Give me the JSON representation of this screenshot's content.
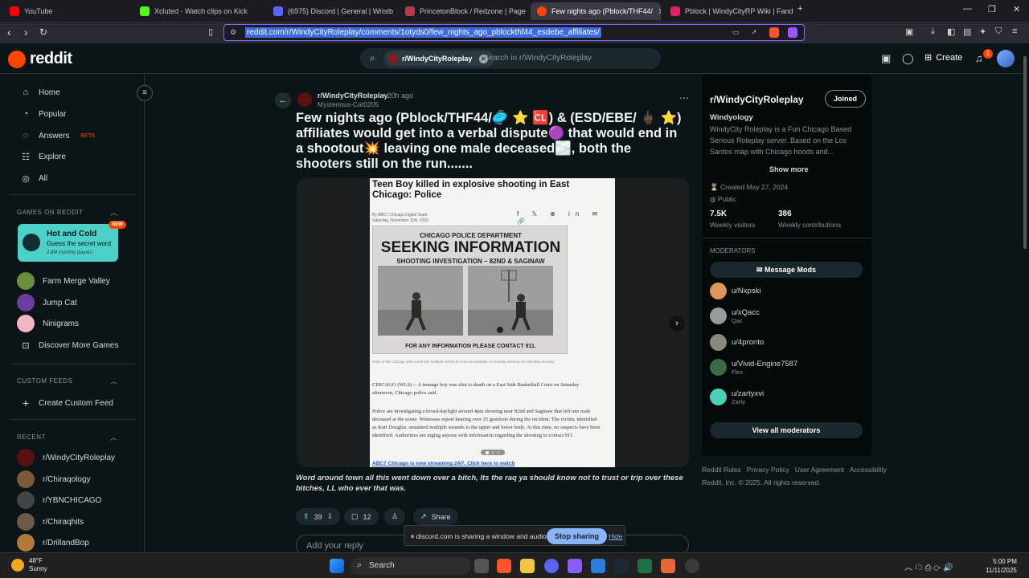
{
  "browser": {
    "tabs": [
      {
        "label": "YouTube",
        "color": "#ff0000"
      },
      {
        "label": "Xcluted - Watch clips on Kick",
        "color": "#53fc18"
      },
      {
        "label": "(6975) Discord | General | Wristb",
        "color": "#5865f2"
      },
      {
        "label": "PrincetonBlock / Redzone | Page",
        "color": "#b23a48"
      },
      {
        "label": "Few nights ago (Pblock/THF44/",
        "color": "#ff4500"
      },
      {
        "label": "Pblock | WindyCityRP Wiki | Fandom",
        "color": "#e0245e"
      }
    ],
    "url": "reddit.com/r/WindyCityRoleplay/comments/1otyds0/few_nights_ago_pblockthf44_esdebe_affiliates/"
  },
  "header": {
    "logo_text": "reddit",
    "search_chip": "r/WindyCityRoleplay",
    "search_placeholder": "Search in r/WindyCityRoleplay",
    "create_label": "Create",
    "notification_count": "1"
  },
  "sidebar": {
    "nav": [
      {
        "label": "Home",
        "icon": "home-icon"
      },
      {
        "label": "Popular",
        "icon": "popular-icon"
      },
      {
        "label": "Answers",
        "icon": "answers-icon",
        "badge": "BETA"
      },
      {
        "label": "Explore",
        "icon": "explore-icon"
      },
      {
        "label": "All",
        "icon": "all-icon"
      }
    ],
    "games_heading": "GAMES ON REDDIT",
    "featured_game": {
      "title": "Hot and Cold",
      "subtitle": "Guess the secret word",
      "users": "2.6M monthly players",
      "badge": "NEW"
    },
    "games": [
      "Farm Merge Valley",
      "Jump Cat",
      "Ninigrams",
      "Discover More Games"
    ],
    "custom_feeds_heading": "CUSTOM FEEDS",
    "create_feed": "Create Custom Feed",
    "recent_heading": "RECENT",
    "recent": [
      "r/WindyCityRoleplay",
      "r/Chiraqology",
      "r/YBNCHICAGO",
      "r/Chiraqhits",
      "r/DrillandBop"
    ]
  },
  "post": {
    "subreddit": "r/WindyCityRoleplay",
    "age": "• 20h ago",
    "author": "Mysterious-Cat0205",
    "title": "Few nights ago (Pblock/THF44/🥏 ⭐ 🆑) & (ESD/EBE/ 🖕🏿 ⭐) affiliates would get into a verbal dispute🟣 that would end in a shootout💥 leaving one male deceased🌫️, both the shooters still on the run.......",
    "image": {
      "headline": "Teen Boy killed in explosive shooting in East Chicago: Police",
      "byline": "By ABC7 Chicago Digital Team\nSaturday, November 11th, 2025",
      "share_icons": "f 𝕏 ⊕ in ✉ 🔗",
      "poster_dept": "CHICAGO POLICE DEPARTMENT",
      "poster_headline": "SEEKING INFORMATION",
      "poster_sub": "SHOOTING INVESTIGATION – 82ND & SAGINAW",
      "poster_contact": "FOR ANY INFORMATION PLEASE CONTACT 911.",
      "caption": "Parts of the Chicago area could see multiple inches of snow accumulate on Sunday evening into Monday morning",
      "para1": "CHICAGO (WLS) -- A teenage boy was shot to death on a East Side Basketball Court on Saturday afternoon, Chicago police said.",
      "para2": "Police are investigating a broad-daylight around 4pm shooting near 82nd and Saginaw that left one male deceased at the scene. Witnesses report hearing over 25 gunshots during the incident. The victim, identified as Kurt Douglas, sustained multiple wounds to the upper and lower body. At this time, no suspects have been identified. Authorities are urging anyone with information regarding the shooting to contact 911.",
      "link": "ABC7 Chicago is now streaming 24/7. Click here to watch"
    },
    "body": "Word around town all this went down over a bitch, Its the raq ya should know not to trust or trip over these bitches, LL who ever that was.",
    "votes": "39",
    "comments": "12",
    "share_label": "Share",
    "reply_placeholder": "Add your reply"
  },
  "community": {
    "name": "r/WindyCityRoleplay",
    "joined_label": "Joined",
    "heading": "Windyology",
    "description": "WindyCity Roleplay is a Fun Chicago Based Serious Roleplay server. Based on the Los Santos map with Chicago hoods and...",
    "show_more": "Show more",
    "created": "Created May 27, 2024",
    "visibility": "Public",
    "visitors": "7.5K",
    "visitors_label": "Weekly visitors",
    "contributions": "386",
    "contributions_label": "Weekly contributions",
    "moderators_heading": "MODERATORS",
    "message_mods": "Message Mods",
    "moderators": [
      {
        "name": "u/Nxpski",
        "flair": ""
      },
      {
        "name": "u/xQacc",
        "flair": "Qac"
      },
      {
        "name": "u/4pronto",
        "flair": ""
      },
      {
        "name": "u/Vivid-Engine7587",
        "flair": "Flex"
      },
      {
        "name": "u/zartyxvi",
        "flair": "Zarty"
      }
    ],
    "view_all": "View all moderators"
  },
  "footer": {
    "links": "Reddit Rules   Privacy Policy   User Agreement   Accessibility",
    "copyright": "Reddit, Inc. © 2025. All rights reserved."
  },
  "sharebar": {
    "text": "discord.com is sharing a window and audio.",
    "stop": "Stop sharing",
    "hide": "Hide"
  },
  "taskbar": {
    "temp": "48°F",
    "condition": "Sunny",
    "search": "Search",
    "time": "5:00 PM",
    "date": "11/11/2025"
  }
}
